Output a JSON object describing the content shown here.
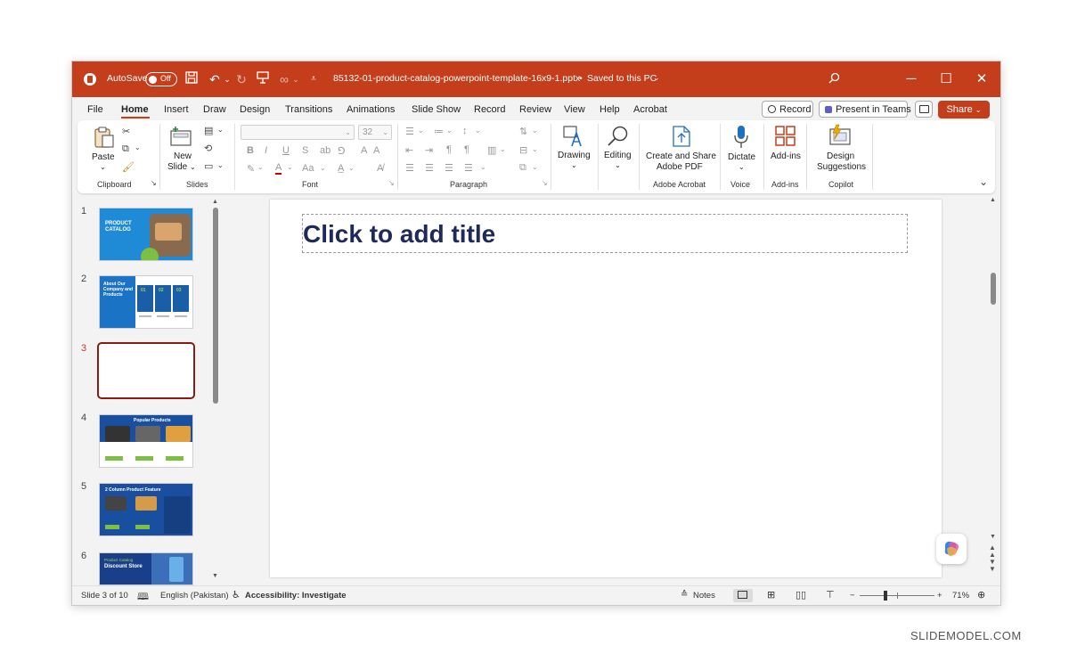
{
  "titlebar": {
    "autosave_label": "AutoSave",
    "autosave_state": "Off",
    "filename": "85132-01-product-catalog-powerpoint-template-16x9-1.pptx",
    "save_status": "Saved to this PC",
    "bg_color": "#c43e1c"
  },
  "menu": {
    "tabs": [
      "File",
      "Home",
      "Insert",
      "Draw",
      "Design",
      "Transitions",
      "Animations",
      "Slide Show",
      "Record",
      "Review",
      "View",
      "Help",
      "Acrobat"
    ],
    "active_tab": "Home",
    "record_label": "Record",
    "present_teams_label": "Present in Teams",
    "share_label": "Share"
  },
  "ribbon": {
    "clipboard": {
      "paste_label": "Paste",
      "group_label": "Clipboard"
    },
    "slides": {
      "new_slide_label_1": "New",
      "new_slide_label_2": "Slide",
      "group_label": "Slides"
    },
    "font": {
      "font_size": "32",
      "group_label": "Font",
      "bold": "B",
      "italic": "I",
      "underline": "U",
      "strike": "S",
      "aa": "Aa"
    },
    "paragraph": {
      "group_label": "Paragraph"
    },
    "drawing": {
      "label": "Drawing"
    },
    "editing": {
      "label": "Editing"
    },
    "adobe": {
      "label_1": "Create and Share",
      "label_2": "Adobe PDF",
      "group_label": "Adobe Acrobat"
    },
    "voice": {
      "label": "Dictate",
      "group_label": "Voice"
    },
    "addins": {
      "label": "Add-ins",
      "group_label": "Add-ins"
    },
    "copilot": {
      "label_1": "Design",
      "label_2": "Suggestions",
      "group_label": "Copilot"
    }
  },
  "thumbnails": [
    {
      "number": "1",
      "title_text": "PRODUCT CATALOG"
    },
    {
      "number": "2",
      "title_text": "About Our Company and Products",
      "cols": [
        "01",
        "02",
        "03"
      ]
    },
    {
      "number": "3",
      "selected": true
    },
    {
      "number": "4",
      "title_text": "Popular Products"
    },
    {
      "number": "5",
      "title_text": "2 Column Product Feature"
    },
    {
      "number": "6",
      "title_text": "Product Catalog",
      "subtitle_text": "Discount Store"
    }
  ],
  "slide": {
    "title_placeholder": "Click to add title"
  },
  "status": {
    "slide_info": "Slide 3 of 10",
    "language": "English (Pakistan)",
    "accessibility": "Accessibility: Investigate",
    "notes_label": "Notes",
    "zoom_minus": "−",
    "zoom_plus": "+",
    "zoom": "71%"
  },
  "watermark": "SLIDEMODEL.COM"
}
